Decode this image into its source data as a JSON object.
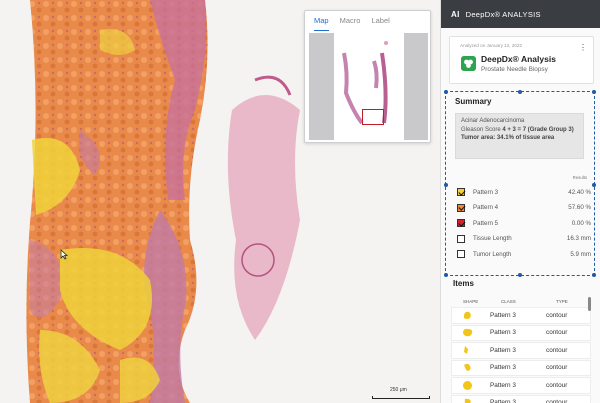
{
  "minimap": {
    "tabs": [
      "Map",
      "Macro",
      "Label"
    ],
    "active_tab": "Map"
  },
  "scalebar": {
    "label": "250 μm"
  },
  "topbar": {
    "logo": "AI",
    "title": "DeepDx® ANALYSIS"
  },
  "analysis_card": {
    "date": "Analyzed on January 12, 2022",
    "app_name": "DeepDx® Analysis",
    "subtitle": "Prostate Needle Biopsy"
  },
  "summary": {
    "heading": "Summary",
    "diagnosis": "Acinar Adenocarcinoma",
    "gleason_prefix": "Gleason Score ",
    "gleason_bold": "4 + 3 = 7 (Grade Group 3)",
    "tumor_area": "Tumor area: 34.1% of tissue area",
    "results_header": "Results",
    "rows": [
      {
        "label": "Pattern 3",
        "value": "42.40 %",
        "color": "#f4d12e",
        "checked": true
      },
      {
        "label": "Pattern 4",
        "value": "57.60 %",
        "color": "#f08a3c",
        "checked": true
      },
      {
        "label": "Pattern 5",
        "value": "0.00 %",
        "color": "#d6222e",
        "checked": true
      },
      {
        "label": "Tissue Length",
        "value": "16.3 mm",
        "color": "#ffffff",
        "checked": false
      },
      {
        "label": "Tumor Length",
        "value": "5.9 mm",
        "color": "#ffffff",
        "checked": false
      }
    ]
  },
  "items": {
    "heading": "Items",
    "columns": [
      "SHAPE",
      "CLASS",
      "TYPE"
    ],
    "rows": [
      {
        "class": "Pattern 3",
        "type": "contour"
      },
      {
        "class": "Pattern 3",
        "type": "contour"
      },
      {
        "class": "Pattern 3",
        "type": "contour"
      },
      {
        "class": "Pattern 3",
        "type": "contour"
      },
      {
        "class": "Pattern 3",
        "type": "contour"
      },
      {
        "class": "Pattern 3",
        "type": "contour"
      }
    ]
  },
  "colors": {
    "accent": "#1f5aa6",
    "pattern3": "#f4d12e",
    "pattern4": "#f08a3c",
    "pattern5": "#d6222e"
  }
}
